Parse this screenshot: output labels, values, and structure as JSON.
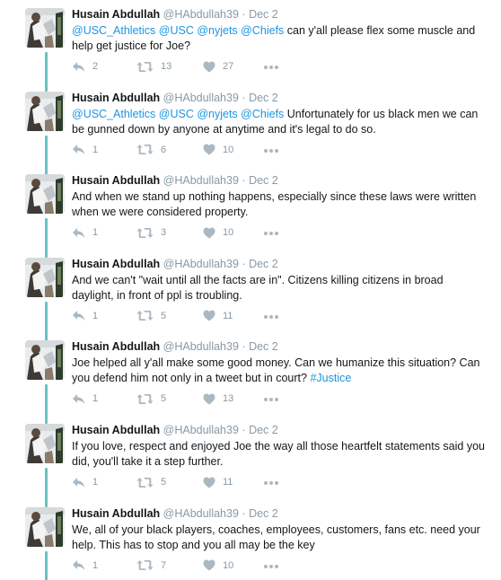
{
  "tweets": [
    {
      "name": "Husain Abdullah",
      "handle": "@HAbdullah39",
      "dot": "·",
      "date": "Dec 2",
      "segments": [
        {
          "t": "@USC_Athletics",
          "c": "mention"
        },
        {
          "t": " ",
          "c": ""
        },
        {
          "t": "@USC",
          "c": "mention"
        },
        {
          "t": " ",
          "c": ""
        },
        {
          "t": "@nyjets",
          "c": "mention"
        },
        {
          "t": " ",
          "c": ""
        },
        {
          "t": "@Chiefs",
          "c": "mention"
        },
        {
          "t": " can y'all please flex some muscle and help get justice for Joe?",
          "c": ""
        }
      ],
      "replies": "2",
      "retweets": "13",
      "likes": "27"
    },
    {
      "name": "Husain Abdullah",
      "handle": "@HAbdullah39",
      "dot": "·",
      "date": "Dec 2",
      "segments": [
        {
          "t": "@USC_Athletics",
          "c": "mention"
        },
        {
          "t": " ",
          "c": ""
        },
        {
          "t": "@USC",
          "c": "mention"
        },
        {
          "t": " ",
          "c": ""
        },
        {
          "t": "@nyjets",
          "c": "mention"
        },
        {
          "t": " ",
          "c": ""
        },
        {
          "t": "@Chiefs",
          "c": "mention"
        },
        {
          "t": " Unfortunately for us black men we can be gunned down by anyone at anytime and it's legal to do so.",
          "c": ""
        }
      ],
      "replies": "1",
      "retweets": "6",
      "likes": "10"
    },
    {
      "name": "Husain Abdullah",
      "handle": "@HAbdullah39",
      "dot": "·",
      "date": "Dec 2",
      "segments": [
        {
          "t": "And when we stand up nothing happens, especially since these laws were written when we were considered property.",
          "c": ""
        }
      ],
      "replies": "1",
      "retweets": "3",
      "likes": "10"
    },
    {
      "name": "Husain Abdullah",
      "handle": "@HAbdullah39",
      "dot": "·",
      "date": "Dec 2",
      "segments": [
        {
          "t": "And we can't \"wait until all the facts are in\". Citizens killing citizens in broad daylight, in front of ppl is troubling.",
          "c": ""
        }
      ],
      "replies": "1",
      "retweets": "5",
      "likes": "11"
    },
    {
      "name": "Husain Abdullah",
      "handle": "@HAbdullah39",
      "dot": "·",
      "date": "Dec 2",
      "segments": [
        {
          "t": "Joe helped all y'all make some good money. Can we humanize this situation? Can you defend him not only in a tweet but in court? ",
          "c": ""
        },
        {
          "t": "#Justice",
          "c": "hashtag"
        }
      ],
      "replies": "1",
      "retweets": "5",
      "likes": "13"
    },
    {
      "name": "Husain Abdullah",
      "handle": "@HAbdullah39",
      "dot": "·",
      "date": "Dec 2",
      "segments": [
        {
          "t": "If you love, respect and enjoyed Joe the way all those heartfelt statements said you did, you'll take it a step further.",
          "c": ""
        }
      ],
      "replies": "1",
      "retweets": "5",
      "likes": "11"
    },
    {
      "name": "Husain Abdullah",
      "handle": "@HAbdullah39",
      "dot": "·",
      "date": "Dec 2",
      "segments": [
        {
          "t": "We, all of your black players, coaches, employees, customers, fans etc. need your help. This has to stop and you all may be the key",
          "c": ""
        }
      ],
      "replies": "1",
      "retweets": "7",
      "likes": "10"
    }
  ],
  "colors": {
    "mention": "#1b95e0",
    "meta": "#8899a6",
    "thread_line": "#69c2c4",
    "text": "#14171a"
  },
  "icons": {
    "reply": "reply-arrow-icon",
    "retweet": "retweet-icon",
    "like": "heart-icon",
    "more": "more-dots-icon"
  }
}
